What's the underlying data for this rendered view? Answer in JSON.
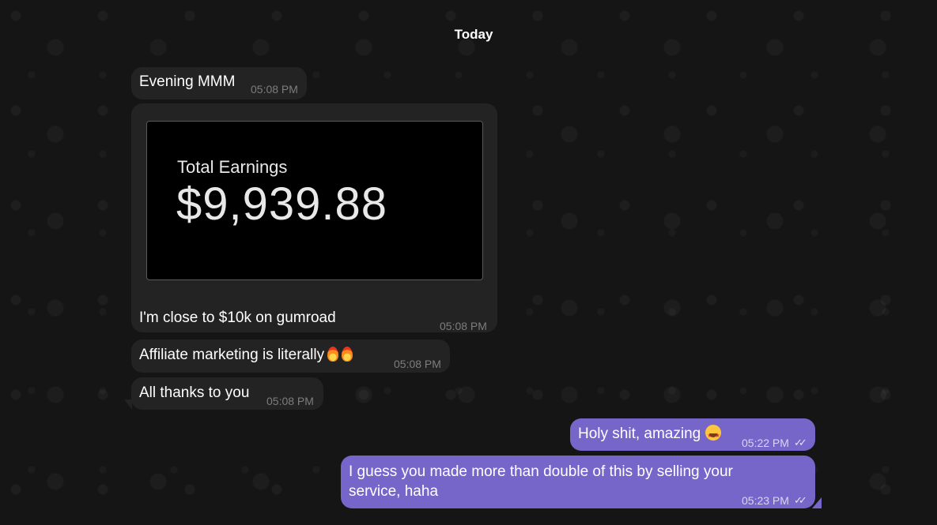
{
  "chat": {
    "date_label": "Today",
    "messages": [
      {
        "direction": "incoming",
        "text": "Evening MMM",
        "time": "05:08 PM"
      },
      {
        "direction": "incoming",
        "image": {
          "label": "Total Earnings",
          "amount": "$9,939.88"
        },
        "text": "I'm close to $10k on gumroad",
        "time": "05:08 PM"
      },
      {
        "direction": "incoming",
        "text": "Affiliate marketing is literally",
        "emoji": [
          "fire-icon",
          "fire-icon"
        ],
        "time": "05:08 PM"
      },
      {
        "direction": "incoming",
        "text": "All thanks to you",
        "time": "05:08 PM"
      },
      {
        "direction": "outgoing",
        "text": "Holy shit, amazing",
        "emoji": [
          "star-struck-icon"
        ],
        "time": "05:22 PM",
        "status": "read"
      },
      {
        "direction": "outgoing",
        "text_lines": [
          "I guess you made more than double of this by selling your",
          "service, haha"
        ],
        "time": "05:23 PM",
        "status": "read"
      }
    ]
  },
  "colors": {
    "incoming_bubble": "#232323",
    "outgoing_bubble": "#7666c9",
    "background": "#171717",
    "timestamp_incoming": "#7d7d7d"
  }
}
